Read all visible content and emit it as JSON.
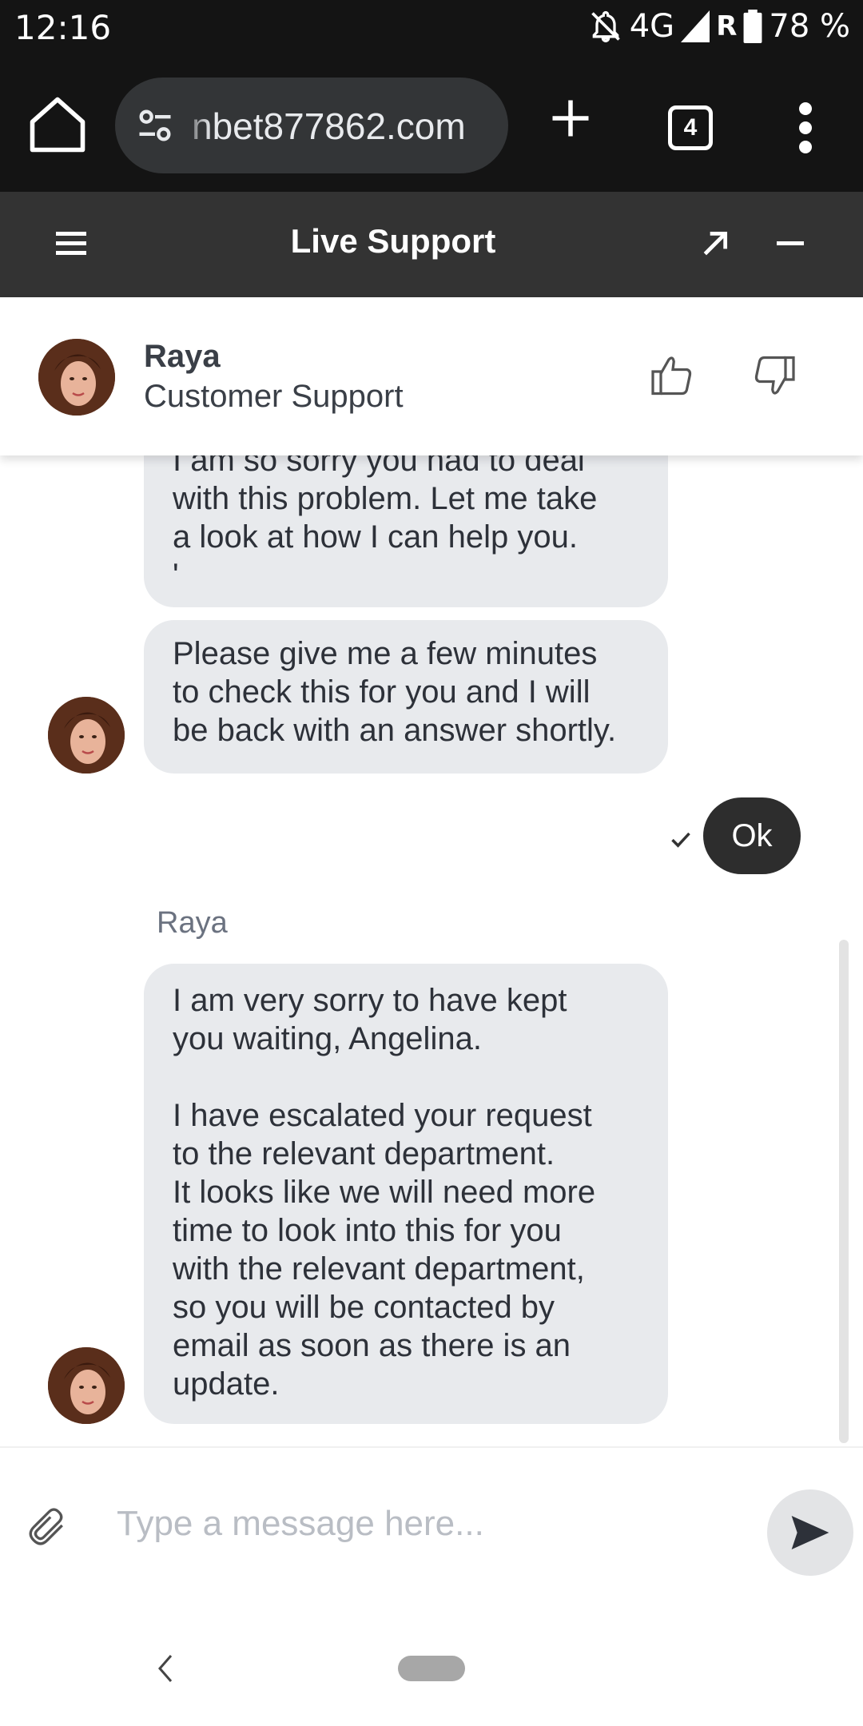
{
  "status_bar": {
    "time": "12:16",
    "network": "4G",
    "roaming": "R",
    "battery": "78 %"
  },
  "browser": {
    "url": "nbet877862.com",
    "tab_count": "4"
  },
  "live_support": {
    "title": "Live Support"
  },
  "agent": {
    "name": "Raya",
    "role": "Customer Support"
  },
  "messages": {
    "m1": "I am so sorry you had to deal\nwith this problem. Let me take\na look at how I can help you.\n'",
    "m2": "Please give me a few minutes\nto check this for you and I will\nbe back with an answer shortly.",
    "user_reply": "Ok",
    "sender_label": "Raya",
    "m3": "I am very sorry to have kept\nyou waiting, Angelina.\n\nI have escalated your request\nto the relevant department.\nIt looks like we will need more\ntime to look into this for you\nwith the relevant department,\nso you will be contacted by\nemail as soon as there is an\nupdate."
  },
  "composer": {
    "placeholder": "Type a message here..."
  },
  "icons": {
    "home": "home-icon",
    "site_info": "tune-icon",
    "new_tab": "plus-icon",
    "tabs": "tab-switcher-icon",
    "more": "more-vert-icon",
    "menu": "hamburger-icon",
    "popout": "arrow-up-right-icon",
    "minimize": "minus-icon",
    "like": "thumbs-up-icon",
    "dislike": "thumbs-down-icon",
    "attach": "paperclip-icon",
    "send": "send-icon"
  },
  "colors": {
    "header_bg": "#333333",
    "agent_bubble": "#e8eaed",
    "user_bubble": "#2d2d2d"
  }
}
